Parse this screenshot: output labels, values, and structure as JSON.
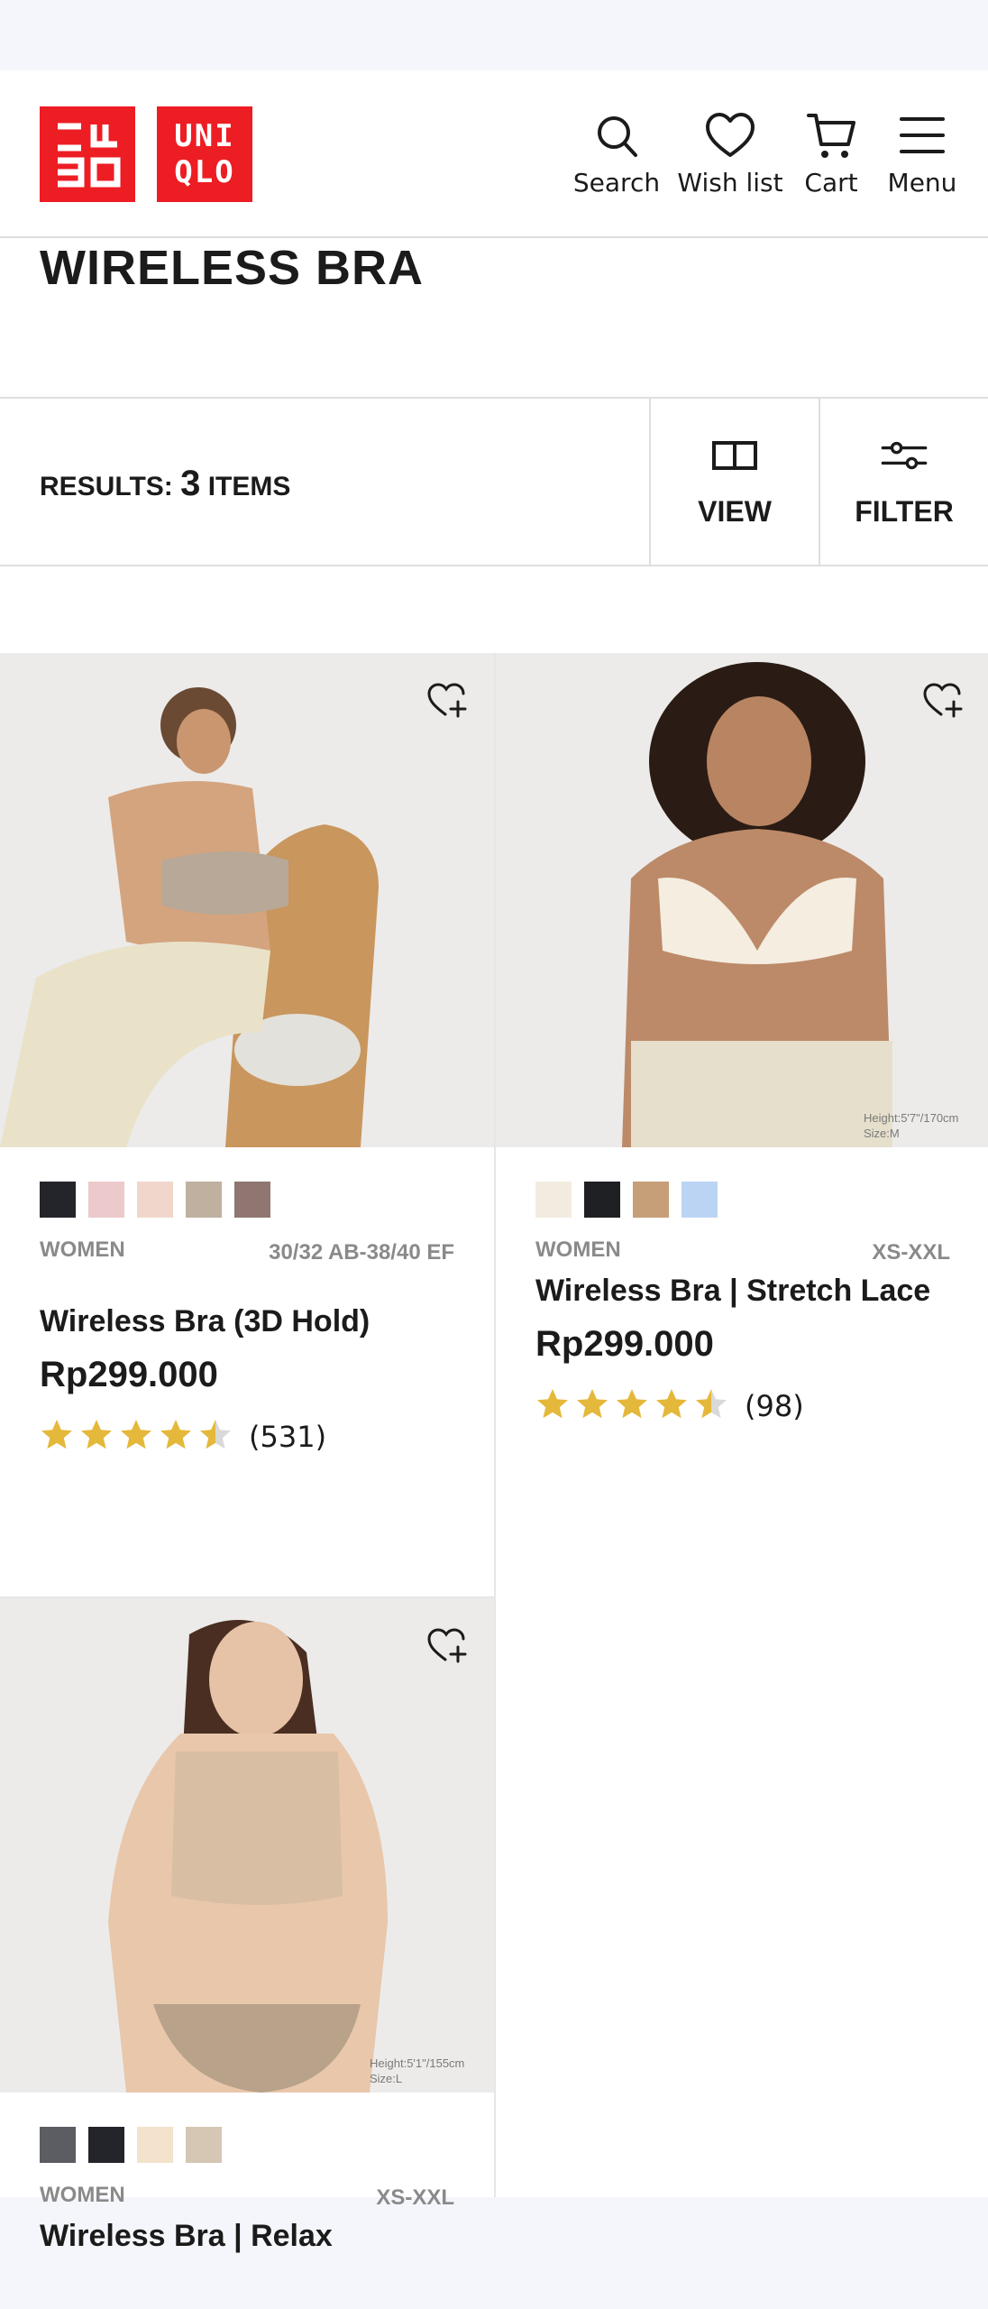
{
  "brand": {
    "logo_lines": [
      "UNI",
      "QLO"
    ],
    "color": "#ed1d24"
  },
  "nav": {
    "search": "Search",
    "wishlist": "Wish list",
    "cart": "Cart",
    "menu": "Menu"
  },
  "page_title": "WIRELESS BRA",
  "results": {
    "prefix": "RESULTS:",
    "count": "3",
    "suffix": "ITEMS"
  },
  "toolbar": {
    "view_label": "VIEW",
    "filter_label": "FILTER"
  },
  "products": [
    {
      "name": "Wireless Bra (3D Hold)",
      "gender": "WOMEN",
      "sizes": "30/32 AB-38/40 EF",
      "price": "Rp299.000",
      "rating": 4.5,
      "reviews": "(531)",
      "swatches": [
        "#23252b",
        "#ecc9cb",
        "#f1d7cb",
        "#bfb0a0",
        "#8f7670"
      ]
    },
    {
      "name": "Wireless Bra | Stretch Lace",
      "gender": "WOMEN",
      "sizes": "XS-XXL",
      "price": "Rp299.000",
      "rating": 4.5,
      "reviews": "(98)",
      "swatches": [
        "#f2ece0",
        "#1f2024",
        "#c69e78",
        "#bcd4f4"
      ],
      "photo_caption": [
        "Height:5'7\"/170cm",
        "Size:M"
      ]
    },
    {
      "name": "Wireless Bra | Relax",
      "gender": "WOMEN",
      "sizes": "XS-XXL",
      "swatches": [
        "#5b5d63",
        "#23252b",
        "#f3e2cc",
        "#d6c6b4"
      ],
      "photo_caption": [
        "Height:5'1\"/155cm",
        "Size:L"
      ]
    }
  ],
  "colors": {
    "star": "#e4b83a",
    "star_empty": "#d9d9d9",
    "muted_text": "#8a8a8a"
  }
}
